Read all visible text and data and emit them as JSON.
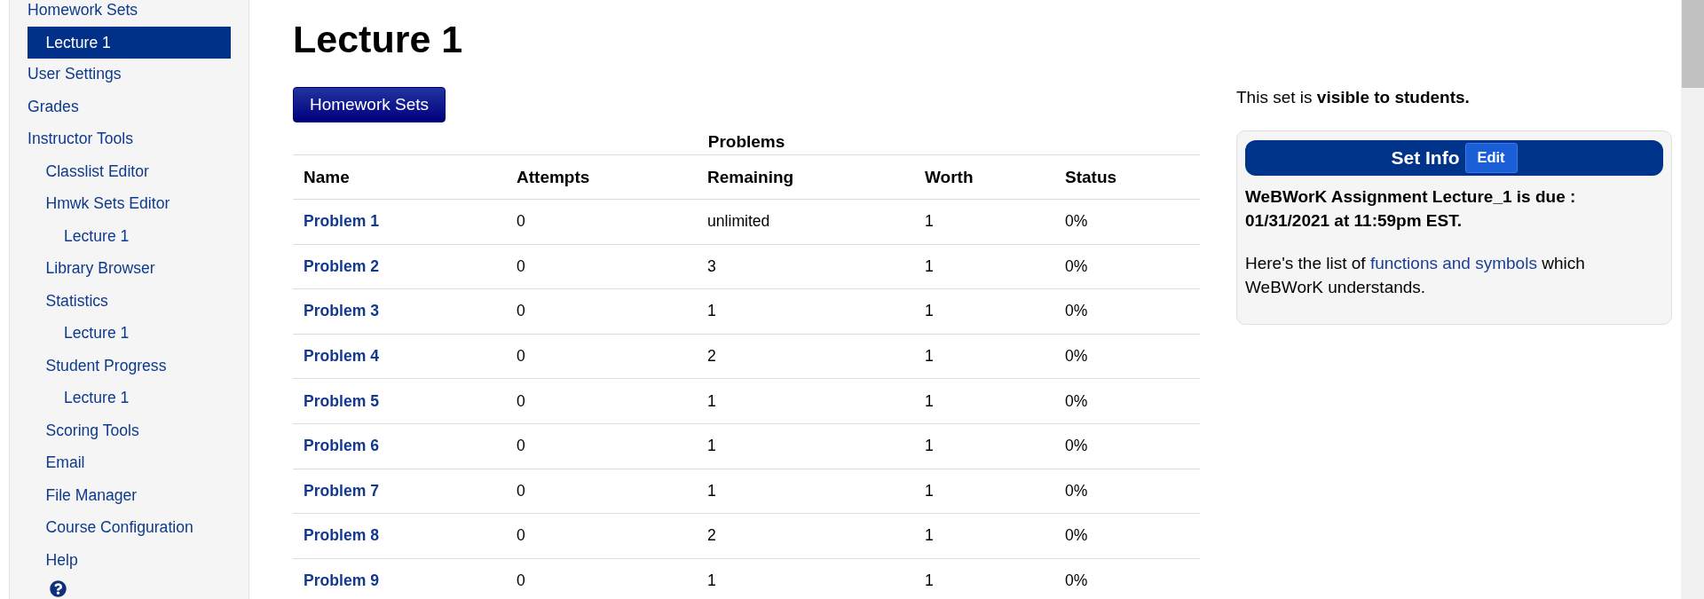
{
  "sidebar": {
    "items": [
      {
        "label": "Homework Sets",
        "selected": false,
        "children": [
          {
            "label": "Lecture 1",
            "selected": true
          }
        ]
      },
      {
        "label": "User Settings",
        "selected": false
      },
      {
        "label": "Grades",
        "selected": false
      },
      {
        "label": "Instructor Tools",
        "selected": false,
        "children": [
          {
            "label": "Classlist Editor",
            "selected": false
          },
          {
            "label": "Hmwk Sets Editor",
            "selected": false,
            "children": [
              {
                "label": "Lecture 1",
                "selected": false
              }
            ]
          },
          {
            "label": "Library Browser",
            "selected": false
          },
          {
            "label": "Statistics",
            "selected": false,
            "children": [
              {
                "label": "Lecture 1",
                "selected": false
              }
            ]
          },
          {
            "label": "Student Progress",
            "selected": false,
            "children": [
              {
                "label": "Lecture 1",
                "selected": false
              }
            ]
          },
          {
            "label": "Scoring Tools",
            "selected": false
          },
          {
            "label": "Email",
            "selected": false
          },
          {
            "label": "File Manager",
            "selected": false
          },
          {
            "label": "Course Configuration",
            "selected": false
          },
          {
            "label": "Help",
            "selected": false
          }
        ]
      }
    ]
  },
  "page_title": "Lecture 1",
  "homework_sets_button": "Homework Sets",
  "table": {
    "caption": "Problems",
    "columns": [
      "Name",
      "Attempts",
      "Remaining",
      "Worth",
      "Status"
    ],
    "rows": [
      {
        "name": "Problem 1",
        "attempts": "0",
        "remaining": "unlimited",
        "worth": "1",
        "status": "0%"
      },
      {
        "name": "Problem 2",
        "attempts": "0",
        "remaining": "3",
        "worth": "1",
        "status": "0%"
      },
      {
        "name": "Problem 3",
        "attempts": "0",
        "remaining": "1",
        "worth": "1",
        "status": "0%"
      },
      {
        "name": "Problem 4",
        "attempts": "0",
        "remaining": "2",
        "worth": "1",
        "status": "0%"
      },
      {
        "name": "Problem 5",
        "attempts": "0",
        "remaining": "1",
        "worth": "1",
        "status": "0%"
      },
      {
        "name": "Problem 6",
        "attempts": "0",
        "remaining": "1",
        "worth": "1",
        "status": "0%"
      },
      {
        "name": "Problem 7",
        "attempts": "0",
        "remaining": "1",
        "worth": "1",
        "status": "0%"
      },
      {
        "name": "Problem 8",
        "attempts": "0",
        "remaining": "2",
        "worth": "1",
        "status": "0%"
      },
      {
        "name": "Problem 9",
        "attempts": "0",
        "remaining": "1",
        "worth": "1",
        "status": "0%"
      }
    ]
  },
  "visibility_note": "This set is **visible to students.**",
  "set_info": {
    "title": "Set Info",
    "edit_button": "Edit",
    "due_text": "WeBWorK Assignment Lecture_1 is due : 01/31/2021 at 11:59pm EST.",
    "help_text": {
      "before": "Here's the list of ",
      "link": "functions and symbols",
      "after": " which WeBWorK understands."
    }
  }
}
